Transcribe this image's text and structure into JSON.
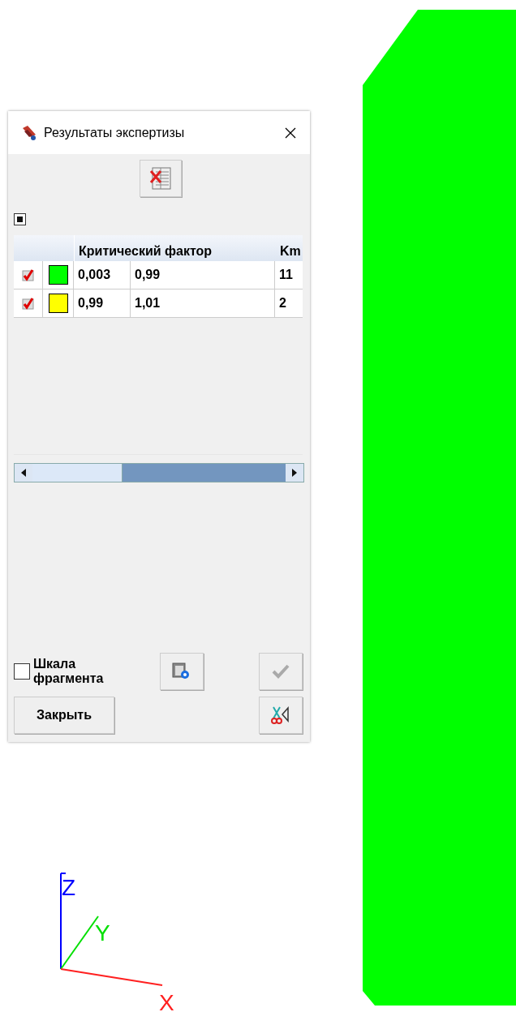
{
  "window": {
    "title": "Результаты экспертизы"
  },
  "toolbar_checkbox": {
    "checked": true
  },
  "table": {
    "header": {
      "group": "Критический фактор",
      "column_3": "Km"
    },
    "rows": [
      {
        "checked": true,
        "color": "#00ff00",
        "cells": [
          "0,003",
          "0,99",
          "11"
        ]
      },
      {
        "checked": true,
        "color": "#ffff00",
        "cells": [
          "0,99",
          "1,01",
          "2"
        ]
      }
    ]
  },
  "scale_checkbox": {
    "label": "Шкала фрагмента",
    "checked": false
  },
  "apply_button": {
    "disabled": true
  },
  "close_button": {
    "label": "Закрыть"
  },
  "axes": [
    {
      "kind": "z",
      "label": "Z",
      "color": "#0000ff"
    },
    {
      "kind": "y",
      "label": "Y",
      "color": "#00e000"
    },
    {
      "kind": "x",
      "label": "X",
      "color": "#ff2020"
    }
  ]
}
